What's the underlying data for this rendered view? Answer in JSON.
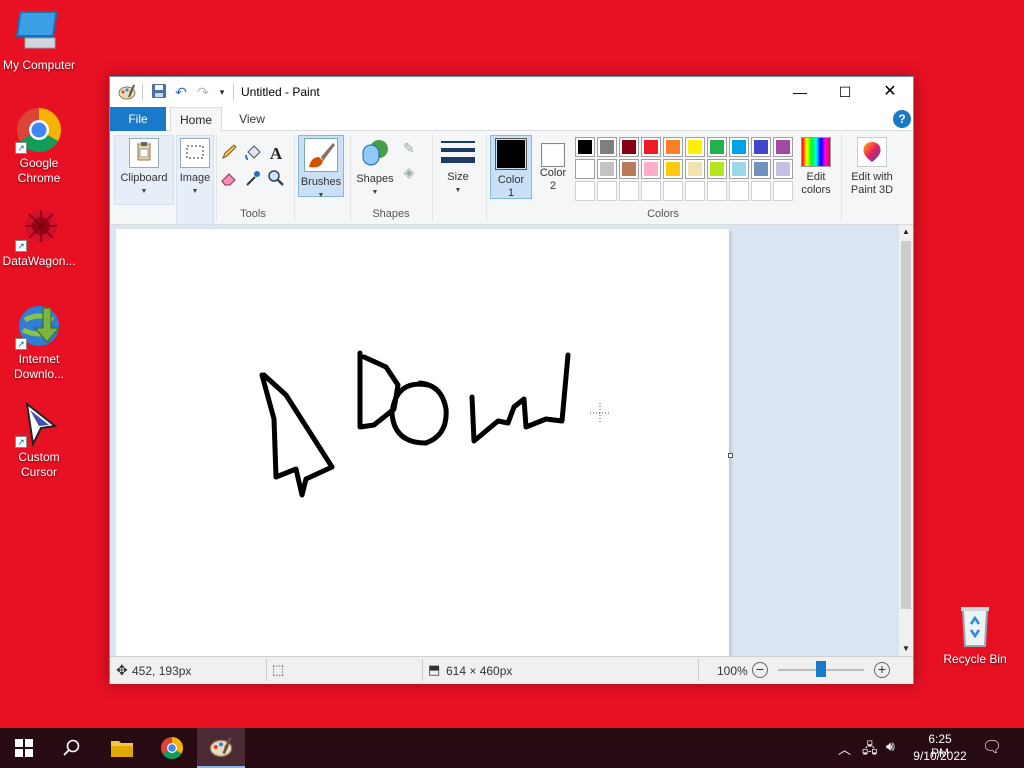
{
  "desktop": {
    "icons": [
      {
        "label": "My Computer",
        "name": "my-computer"
      },
      {
        "label": "Google\nChrome",
        "name": "google-chrome"
      },
      {
        "label": "DataWagon...",
        "name": "datawagon"
      },
      {
        "label": "Internet\nDownlo...",
        "name": "internet-download-manager"
      },
      {
        "label": "Custom\nCursor",
        "name": "custom-cursor"
      },
      {
        "label": "Recycle Bin",
        "name": "recycle-bin"
      }
    ]
  },
  "window": {
    "title": "Untitled - Paint",
    "tabs": {
      "file": "File",
      "home": "Home",
      "view": "View"
    },
    "ribbon": {
      "clipboard": "Clipboard",
      "image": "Image",
      "tools": "Tools",
      "brushes": "Brushes",
      "shapes_btn": "Shapes",
      "shapes_group": "Shapes",
      "size": "Size",
      "color1": "Color\n1",
      "color2": "Color\n2",
      "edit_colors": "Edit\ncolors",
      "paint3d": "Edit with\nPaint 3D",
      "colors_group": "Colors",
      "text_tool": "A"
    },
    "palette_row1": [
      "#000000",
      "#7f7f7f",
      "#880015",
      "#ed1c24",
      "#ff7f27",
      "#fff200",
      "#22b14c",
      "#00a2e8",
      "#3f48cc",
      "#a349a4"
    ],
    "palette_row2": [
      "#ffffff",
      "#c3c3c3",
      "#b97a57",
      "#ffaec9",
      "#ffc90e",
      "#efe4b0",
      "#b5e61d",
      "#99d9ea",
      "#7092be",
      "#c8bfe7"
    ],
    "color1_value": "#000000",
    "color2_value": "#ffffff",
    "status": {
      "cursor_pos": "452, 193px",
      "canvas_size": "614 × 460px",
      "zoom": "100%",
      "zoom_level": 1.0
    }
  },
  "taskbar": {
    "time": "6:25 PM",
    "date": "9/10/2022"
  }
}
